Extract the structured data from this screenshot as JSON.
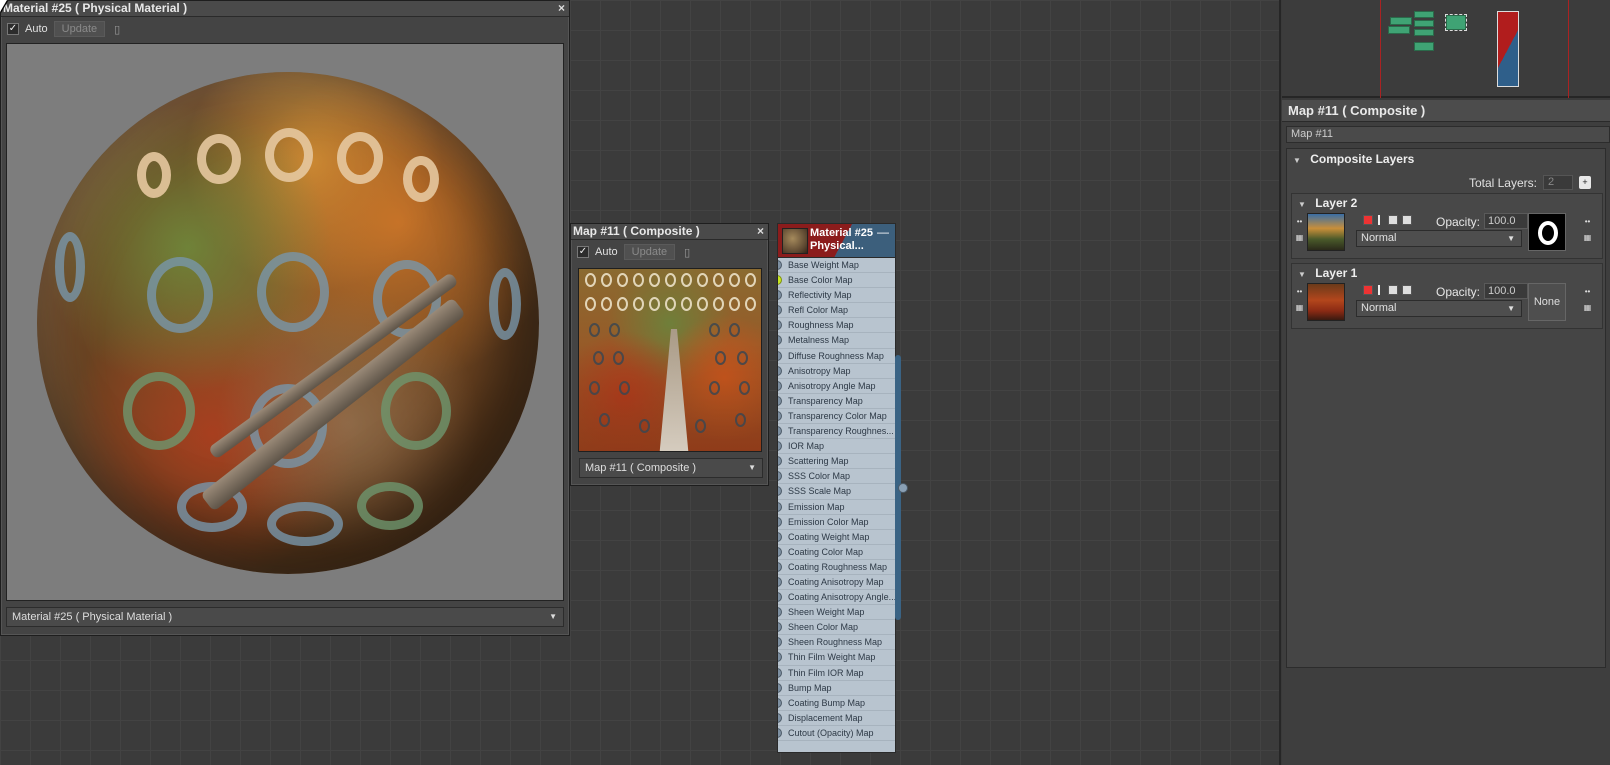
{
  "material_window": {
    "title": "Material #25  ( Physical Material )",
    "auto_label": "Auto",
    "auto_checked": true,
    "update_label": "Update",
    "dropdown_value": "Material #25  ( Physical Material )"
  },
  "map_window": {
    "title": "Map #11  ( Composite )",
    "auto_label": "Auto",
    "auto_checked": true,
    "update_label": "Update",
    "dropdown_value": "Map #11  ( Composite )"
  },
  "node": {
    "title_line1": "Material #25",
    "title_line2": "Physical...",
    "minimize_symbol": "—",
    "slots": [
      "Base Weight Map",
      "Base Color Map",
      "Reflectivity Map",
      "Refl Color Map",
      "Roughness Map",
      "Metalness Map",
      "Diffuse Roughness Map",
      "Anisotropy Map",
      "Anisotropy Angle Map",
      "Transparency Map",
      "Transparency Color Map",
      "Transparency Roughnes...",
      "IOR Map",
      "Scattering Map",
      "SSS Color Map",
      "SSS Scale Map",
      "Emission Map",
      "Emission Color Map",
      "Coating Weight Map",
      "Coating Color Map",
      "Coating Roughness Map",
      "Coating Anisotropy Map",
      "Coating Anisotropy Angle...",
      "Sheen Weight Map",
      "Sheen Color Map",
      "Sheen Roughness Map",
      "Thin Film Weight Map",
      "Thin Film IOR Map",
      "Bump Map",
      "Coating Bump Map",
      "Displacement Map",
      "Cutout (Opacity) Map"
    ],
    "active_slot_index": 1,
    "active_socket_color": "#c8e61e"
  },
  "properties": {
    "title": "Map #11  ( Composite )",
    "name_field": "Map #11",
    "rollout_title": "Composite Layers",
    "total_layers_label": "Total Layers:",
    "total_layers_value": "2",
    "layers": [
      {
        "label": "Layer 2",
        "opacity_label": "Opacity:",
        "opacity_value": "100.0",
        "blend_mode": "Normal",
        "mask": "ring-mask"
      },
      {
        "label": "Layer 1",
        "opacity_label": "Opacity:",
        "opacity_value": "100.0",
        "blend_mode": "Normal",
        "mask_label": "None"
      }
    ]
  },
  "colors": {
    "material_accent": "#8b1c1c",
    "map_accent": "#3c5f7c",
    "navigator_nodes": "#3fa374",
    "graph_bg": "#3b3b3b"
  }
}
